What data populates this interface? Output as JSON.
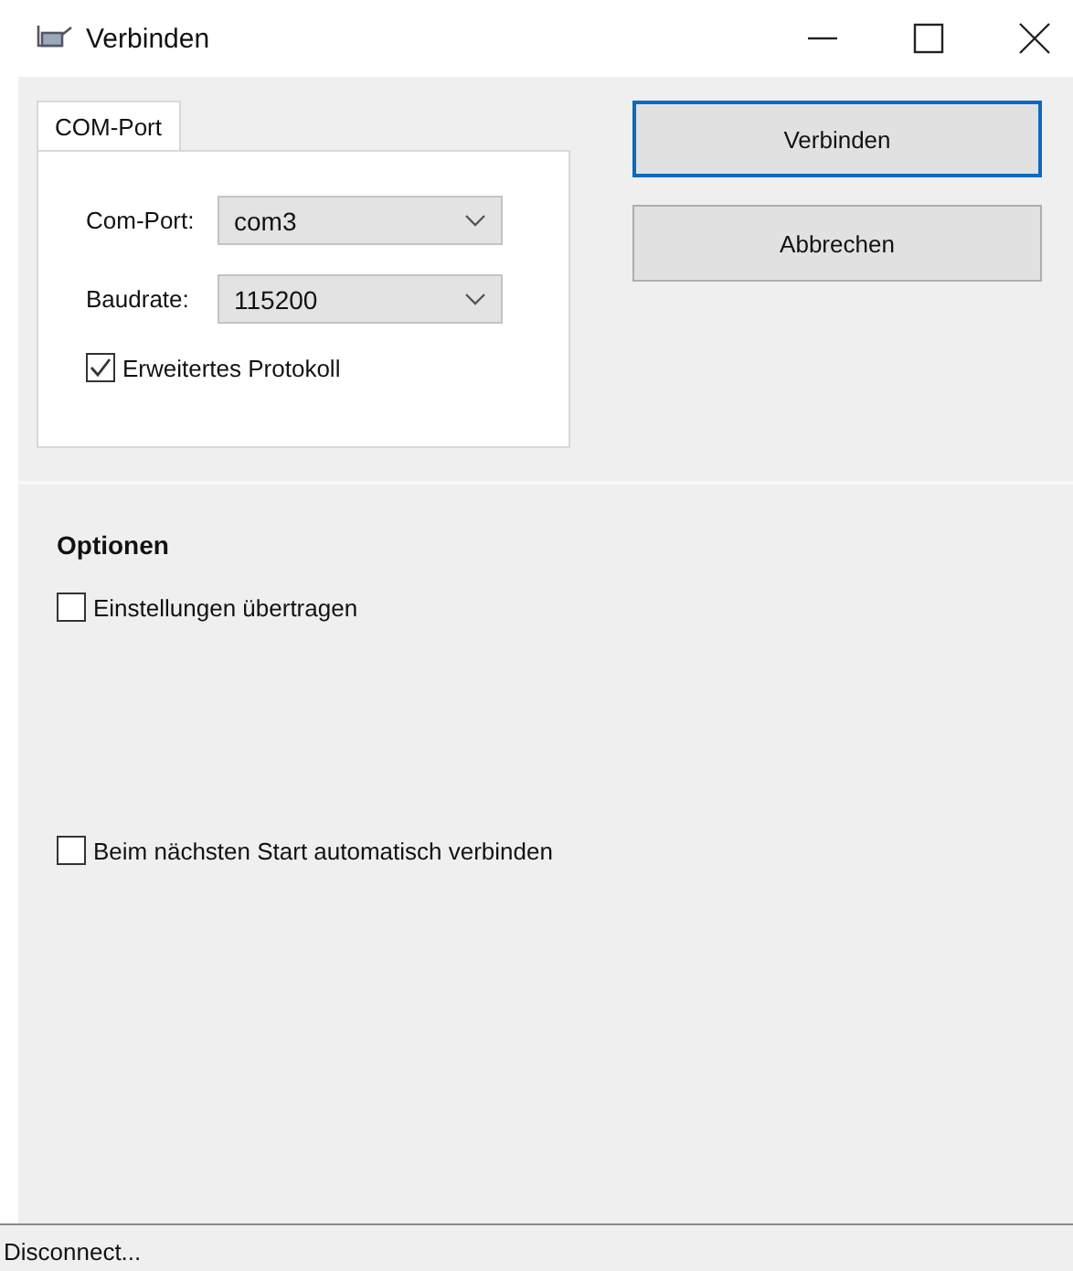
{
  "window": {
    "title": "Verbinden"
  },
  "tabs": [
    {
      "label": "COM-Port",
      "selected": true
    }
  ],
  "fields": [
    {
      "label": "Com-Port:",
      "value": "com3"
    },
    {
      "label": "Baudrate:",
      "value": "115200"
    }
  ],
  "extended_protocol": {
    "label": "Erweitertes Protokoll",
    "checked": true
  },
  "buttons": [
    {
      "label": "Verbinden",
      "selected": true
    },
    {
      "label": "Abbrechen",
      "selected": false
    }
  ],
  "options": {
    "title": "Optionen",
    "items": [
      {
        "label": "Einstellungen übertragen",
        "checked": false
      },
      {
        "label": "Beim nächsten Start automatisch verbinden",
        "checked": false
      }
    ]
  },
  "status_bar": "Disconnect..."
}
